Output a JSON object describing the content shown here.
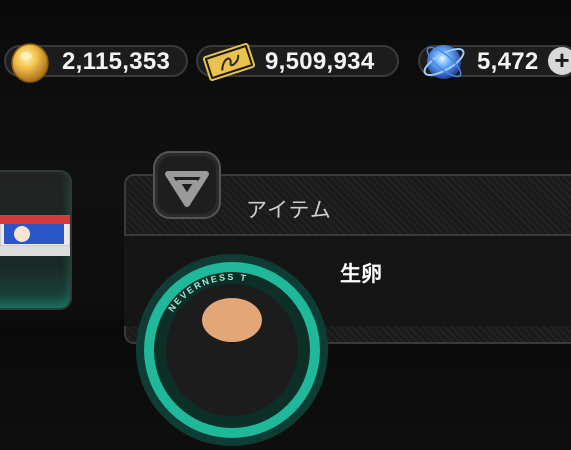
{
  "currency": {
    "gold": {
      "icon": "gold-coin-icon",
      "value": "2,115,353"
    },
    "ticket": {
      "icon": "gold-ticket-icon",
      "value": "9,509,934"
    },
    "crystal": {
      "icon": "blue-orb-icon",
      "value": "5,472"
    },
    "add_label": "+"
  },
  "panel": {
    "section_title": "アイテム",
    "item_name": "生卵",
    "badge_text": "NEVERNESS T"
  },
  "colors": {
    "accent_teal": "#1fb89a",
    "gold": "#e9b23a",
    "crystal_blue": "#3d7fe0"
  }
}
